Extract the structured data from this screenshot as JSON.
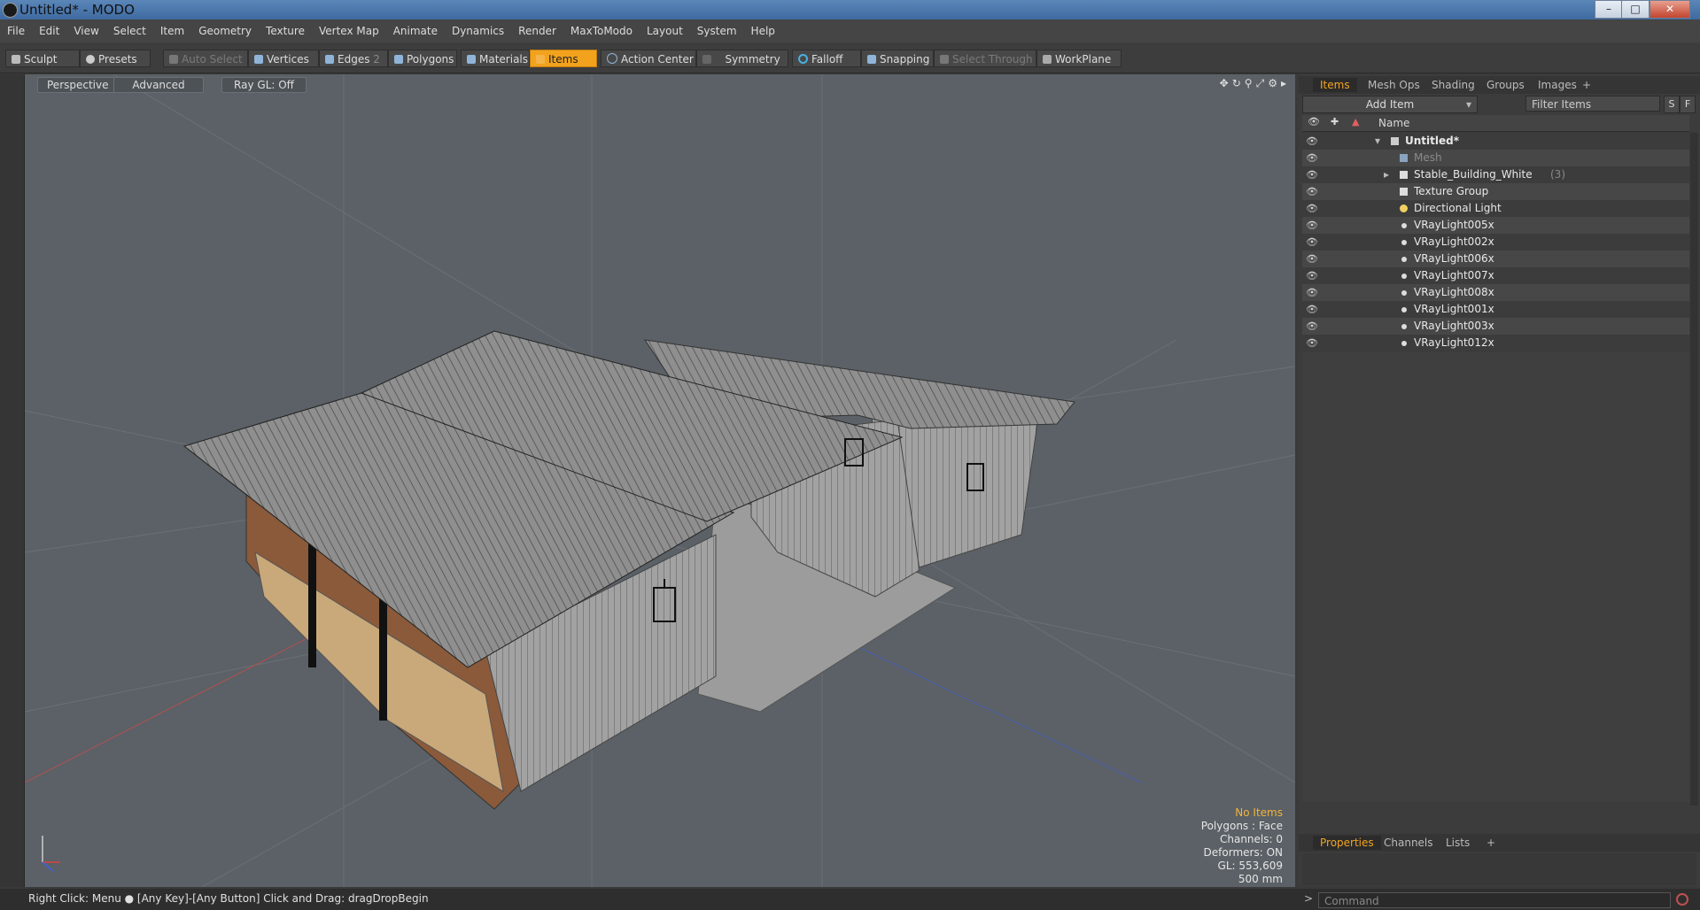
{
  "window": {
    "title": "Untitled* - MODO"
  },
  "menu": [
    "File",
    "Edit",
    "View",
    "Select",
    "Item",
    "Geometry",
    "Texture",
    "Vertex Map",
    "Animate",
    "Dynamics",
    "Render",
    "MaxToModo",
    "Layout",
    "System",
    "Help"
  ],
  "toolbar": {
    "sculpt": "Sculpt",
    "presets": "Presets",
    "auto_select": "Auto Select",
    "vertices": "Vertices",
    "edges": "Edges",
    "edges_count": "2",
    "polygons": "Polygons",
    "materials": "Materials",
    "items": "Items",
    "action_center": "Action Center",
    "symmetry": "Symmetry",
    "falloff": "Falloff",
    "snapping": "Snapping",
    "select_through": "Select Through",
    "workplane": "WorkPlane"
  },
  "viewport": {
    "tabs": [
      "Perspective",
      "Advanced",
      "Ray GL: Off"
    ],
    "hud": [
      "No Items",
      "Polygons : Face",
      "Channels: 0",
      "Deformers: ON",
      "GL: 553,609",
      "500 mm"
    ]
  },
  "right_panel": {
    "tabs": [
      "Items",
      "Mesh Ops",
      "Shading",
      "Groups",
      "Images",
      "+"
    ],
    "add_item": "Add Item",
    "filter_placeholder": "Filter Items",
    "filter_s": "S",
    "filter_f": "F",
    "column_name": "Name",
    "tree": [
      {
        "label": "Untitled*",
        "count": ""
      },
      {
        "label": "Mesh",
        "count": ""
      },
      {
        "label": "Stable_Building_White",
        "count": "(3)"
      },
      {
        "label": "Texture Group",
        "count": ""
      },
      {
        "label": "Directional Light",
        "count": ""
      },
      {
        "label": "VRayLight005x",
        "count": ""
      },
      {
        "label": "VRayLight002x",
        "count": ""
      },
      {
        "label": "VRayLight006x",
        "count": ""
      },
      {
        "label": "VRayLight007x",
        "count": ""
      },
      {
        "label": "VRayLight008x",
        "count": ""
      },
      {
        "label": "VRayLight001x",
        "count": ""
      },
      {
        "label": "VRayLight003x",
        "count": ""
      },
      {
        "label": "VRayLight012x",
        "count": ""
      }
    ],
    "bottom_tabs": [
      "Properties",
      "Channels",
      "Lists",
      "+"
    ]
  },
  "status": {
    "text": "Right Click: Menu ●  [Any Key]-[Any Button] Click and Drag: dragDropBegin",
    "command_placeholder": "Command",
    "prompt": ">"
  },
  "colors": {
    "accent": "#f2a21d",
    "viewport_bg": "#5b6166",
    "panel_bg": "#3c3c3c"
  }
}
